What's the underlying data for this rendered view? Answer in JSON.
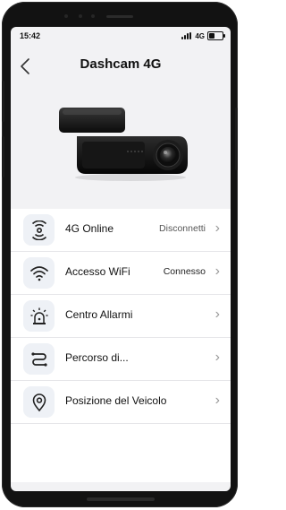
{
  "status_bar": {
    "time": "15:42",
    "network": "4G"
  },
  "header": {
    "title": "Dashcam 4G",
    "back_icon": "chevron-left-icon"
  },
  "menu": [
    {
      "label": "4G Online",
      "value": "Disconnetti",
      "icon": "4g-signal-icon"
    },
    {
      "label": "Accesso WiFi",
      "value": "Connesso",
      "icon": "wifi-icon"
    },
    {
      "label": "Centro Allarmi",
      "value": "",
      "icon": "alarm-light-icon"
    },
    {
      "label": "Percorso di...",
      "value": "",
      "icon": "route-icon"
    },
    {
      "label": "Posizione del Veicolo",
      "value": "",
      "icon": "location-pin-icon"
    }
  ],
  "colors": {
    "icon_bg": "#eef1f6",
    "screen_bg": "#f2f2f4"
  }
}
